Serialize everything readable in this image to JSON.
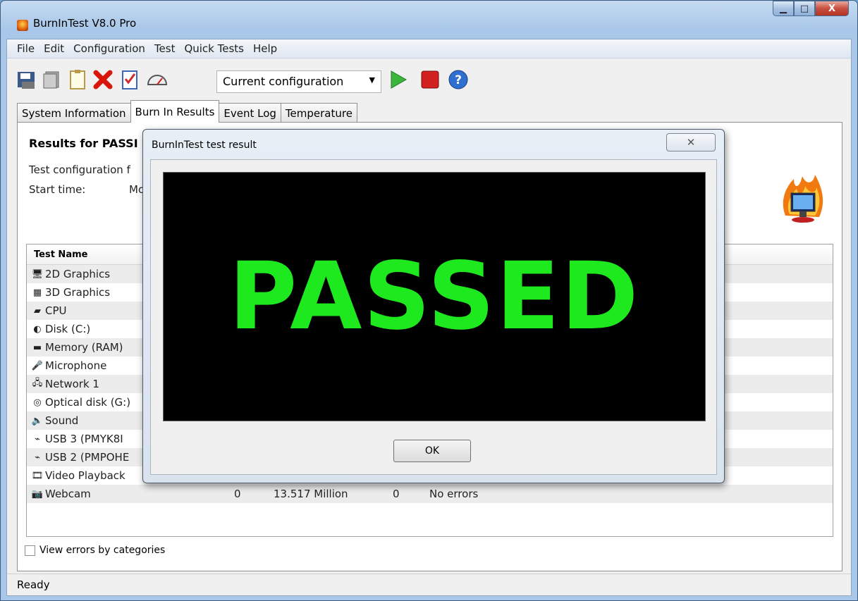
{
  "window": {
    "title": "BurnInTest V8.0 Pro"
  },
  "menu": [
    "File",
    "Edit",
    "Configuration",
    "Test",
    "Quick Tests",
    "Help"
  ],
  "toolbar": {
    "config_value": "Current configuration"
  },
  "tabs": [
    {
      "label": "System Information",
      "active": false
    },
    {
      "label": "Burn In Results",
      "active": true
    },
    {
      "label": "Event Log",
      "active": false
    },
    {
      "label": "Temperature",
      "active": false
    }
  ],
  "results": {
    "heading": "Results for PASSI",
    "config_label": "Test configuration f",
    "start_label": "Start time:",
    "start_value": "Mo"
  },
  "table": {
    "header": "Test Name",
    "rows": [
      {
        "name": "2D Graphics",
        "icon": "monitor-icon"
      },
      {
        "name": "3D Graphics",
        "icon": "cubes-icon"
      },
      {
        "name": "CPU",
        "icon": "cpu-icon"
      },
      {
        "name": "Disk (C:)",
        "icon": "disk-icon"
      },
      {
        "name": "Memory (RAM)",
        "icon": "memory-icon"
      },
      {
        "name": "Microphone",
        "icon": "microphone-icon"
      },
      {
        "name": "Network 1",
        "icon": "network-icon"
      },
      {
        "name": "Optical disk (G:)",
        "icon": "optical-disk-icon"
      },
      {
        "name": "Sound",
        "icon": "speaker-icon"
      },
      {
        "name": "USB 3 (PMYK8I",
        "icon": "usb-icon"
      },
      {
        "name": "USB 2 (PMPOHE",
        "icon": "usb-icon"
      },
      {
        "name": "Video Playback",
        "icon": "film-icon"
      },
      {
        "name": "Webcam",
        "icon": "webcam-icon",
        "cycles": "0",
        "ops": "13.517 Million",
        "errors": "0",
        "last_error": "No errors"
      }
    ]
  },
  "options": {
    "view_errors": "View errors by categories"
  },
  "status": "Ready",
  "dialog": {
    "title": "BurnInTest test result",
    "result": "PASSED",
    "ok": "OK",
    "close_glyph": "✕"
  },
  "colors": {
    "passed_green": "#1ee81e",
    "titlebar": "#a9c7e8"
  }
}
